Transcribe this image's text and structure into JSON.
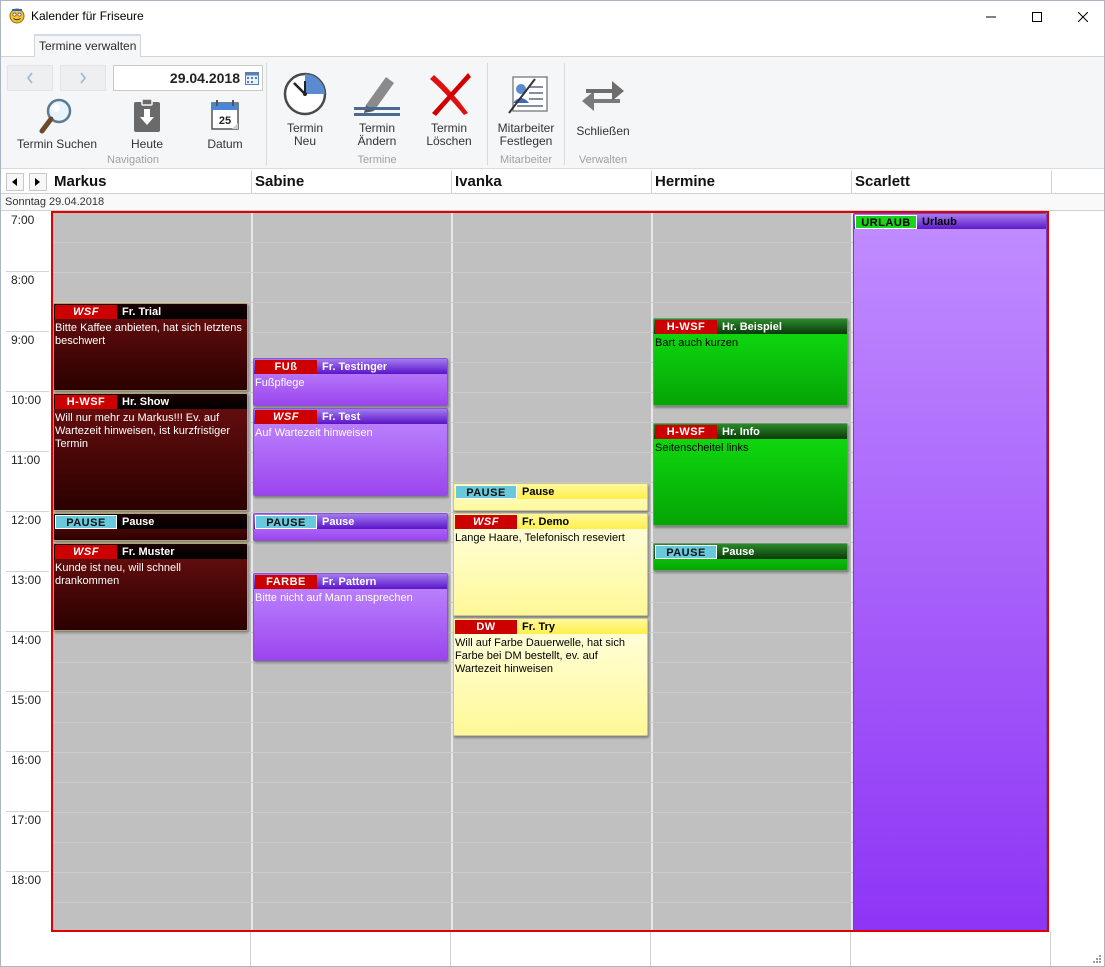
{
  "window": {
    "title": "Kalender für Friseure"
  },
  "ribbon": {
    "tab": "Termine verwalten",
    "date_value": "29.04.2018",
    "buttons": {
      "search": "Termin Suchen",
      "today": "Heute",
      "date": "Datum",
      "new_1": "Termin",
      "new_2": "Neu",
      "edit_1": "Termin",
      "edit_2": "Ändern",
      "delete_1": "Termin",
      "delete_2": "Löschen",
      "staff_1": "Mitarbeiter",
      "staff_2": "Festlegen",
      "close": "Schließen"
    },
    "groups": {
      "navigation": "Navigation",
      "termine": "Termine",
      "mitarbeiter": "Mitarbeiter",
      "verwalten": "Verwalten"
    },
    "calendar_icon_day": "25"
  },
  "calendar": {
    "day_label": "Sonntag 29.04.2018",
    "columns": [
      "Markus",
      "Sabine",
      "Ivanka",
      "Hermine",
      "Scarlett"
    ],
    "hours": [
      "7:00",
      "8:00",
      "9:00",
      "10:00",
      "11:00",
      "12:00",
      "13:00",
      "14:00",
      "15:00",
      "16:00",
      "17:00",
      "18:00"
    ]
  },
  "appointments": [
    {
      "col": 0,
      "start": "8:30",
      "end": "10:00",
      "style": "dark",
      "badge": "WSF",
      "badge_style": "red",
      "title": "Fr. Trial",
      "desc": "Bitte Kaffee anbieten, hat sich letztens beschwert"
    },
    {
      "col": 0,
      "start": "10:00",
      "end": "12:00",
      "style": "dark",
      "badge": "H-WSF",
      "badge_style": "red-nonit",
      "title": "Hr. Show",
      "desc": "Will nur mehr zu Markus!!! Ev. auf Wartezeit hinweisen, ist kurzfristiger Termin"
    },
    {
      "col": 0,
      "start": "12:00",
      "end": "12:30",
      "style": "dark",
      "badge": "PAUSE",
      "badge_style": "pause",
      "title": "Pause",
      "desc": ""
    },
    {
      "col": 0,
      "start": "12:30",
      "end": "14:00",
      "style": "dark",
      "badge": "WSF",
      "badge_style": "red",
      "title": "Fr. Muster",
      "desc": "Kunde ist neu, will schnell drankommen"
    },
    {
      "col": 1,
      "start": "9:25",
      "end": "10:15",
      "style": "purple",
      "badge": "FUß",
      "badge_style": "red-nonit",
      "title": "Fr. Testinger",
      "desc": "Fußpflege"
    },
    {
      "col": 1,
      "start": "10:15",
      "end": "11:45",
      "style": "purple",
      "badge": "WSF",
      "badge_style": "red",
      "title": "Fr. Test",
      "desc": "Auf Wartezeit hinweisen"
    },
    {
      "col": 1,
      "start": "12:00",
      "end": "12:30",
      "style": "purple",
      "badge": "PAUSE",
      "badge_style": "pause",
      "title": "Pause",
      "desc": ""
    },
    {
      "col": 1,
      "start": "13:00",
      "end": "14:30",
      "style": "purple",
      "badge": "FARBE",
      "badge_style": "red-nonit",
      "title": "Fr. Pattern",
      "desc": "Bitte nicht auf Mann ansprechen"
    },
    {
      "col": 2,
      "start": "11:30",
      "end": "12:00",
      "style": "yellow",
      "badge": "PAUSE",
      "badge_style": "pause",
      "title": "Pause",
      "desc": ""
    },
    {
      "col": 2,
      "start": "12:00",
      "end": "13:45",
      "style": "yellow",
      "badge": "WSF",
      "badge_style": "red",
      "title": "Fr. Demo",
      "desc": "Lange Haare, Telefonisch reseviert"
    },
    {
      "col": 2,
      "start": "13:45",
      "end": "15:45",
      "style": "yellow",
      "badge": "DW",
      "badge_style": "red-nonit",
      "title": "Fr. Try",
      "desc": "Will auf Farbe Dauerwelle, hat sich Farbe bei DM bestellt, ev. auf Wartezeit hinweisen"
    },
    {
      "col": 3,
      "start": "8:45",
      "end": "10:15",
      "style": "green",
      "badge": "H-WSF",
      "badge_style": "red-nonit",
      "title": "Hr. Beispiel",
      "desc": "Bart auch kurzen"
    },
    {
      "col": 3,
      "start": "10:30",
      "end": "12:15",
      "style": "green",
      "badge": "H-WSF",
      "badge_style": "red-nonit",
      "title": "Hr. Info",
      "desc": "Seitenscheitel links"
    },
    {
      "col": 3,
      "start": "12:30",
      "end": "13:00",
      "style": "green",
      "badge": "PAUSE",
      "badge_style": "pause",
      "title": "Pause",
      "desc": ""
    },
    {
      "col": 4,
      "start": "7:00",
      "end": "19:00",
      "style": "urlaubbox",
      "badge": "URLAUB",
      "badge_style": "urlaub",
      "title": "Urlaub",
      "desc": ""
    }
  ],
  "colors": {
    "grid_border": "#e00000",
    "grid_bg": "#c0c0c0",
    "wsf_badge": "#cc0000",
    "pause_badge": "#69c9dc",
    "urlaub_badge": "#1ad41a"
  }
}
